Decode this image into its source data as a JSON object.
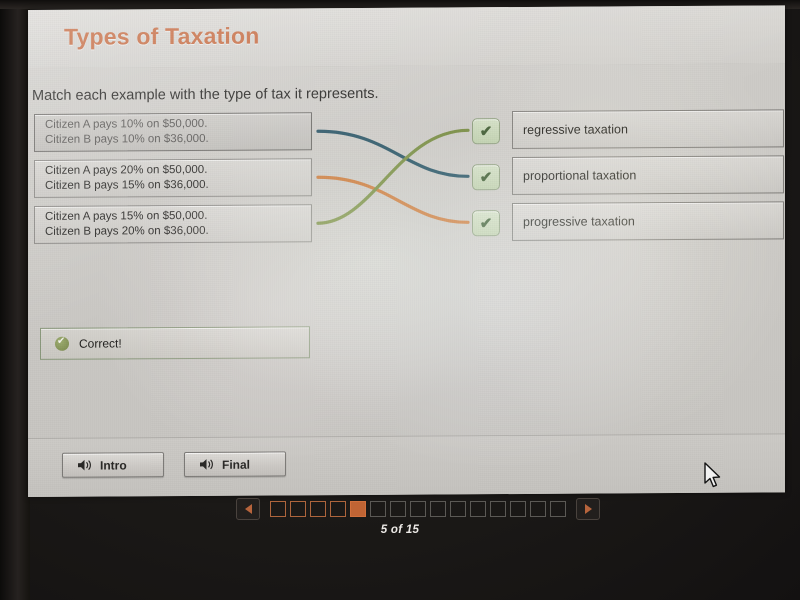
{
  "header": {
    "title": "Types of Taxation"
  },
  "instruction": "Match each example with the type of tax it represents.",
  "match": {
    "prompts": [
      {
        "line1": "Citizen A pays 10% on $50,000.",
        "line2": "Citizen B pays 10% on $36,000."
      },
      {
        "line1": "Citizen A pays 20% on $50,000.",
        "line2": "Citizen B pays 15% on $36,000."
      },
      {
        "line1": "Citizen A pays 15% on $50,000.",
        "line2": "Citizen B pays 20% on $36,000."
      }
    ],
    "answers": [
      {
        "label": "regressive taxation"
      },
      {
        "label": "proportional taxation"
      },
      {
        "label": "progressive taxation"
      }
    ],
    "check_mark": "✔",
    "connections": [
      {
        "from": 0,
        "to": 1,
        "color": "#2c5668"
      },
      {
        "from": 1,
        "to": 2,
        "color": "#cd7b3f"
      },
      {
        "from": 2,
        "to": 0,
        "color": "#7b8f46"
      }
    ]
  },
  "feedback": {
    "text": "Correct!",
    "icon": "check-circle-icon"
  },
  "footer": {
    "buttons": [
      {
        "label": "Intro",
        "icon": "speaker-icon"
      },
      {
        "label": "Final",
        "icon": "speaker-icon"
      }
    ]
  },
  "pagination": {
    "prev_icon": "triangle-left-icon",
    "next_icon": "triangle-right-icon",
    "total": 15,
    "current": 5,
    "visited": 4,
    "counter": "5 of 15"
  },
  "cursor": {
    "icon": "arrow-cursor-icon"
  }
}
